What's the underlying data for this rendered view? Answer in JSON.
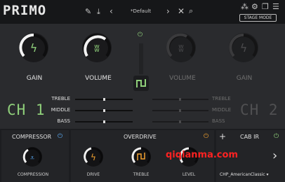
{
  "app": {
    "title": "PRIMO"
  },
  "toolbar": {
    "preset": "*Default",
    "stage_mode_label": "STAGE MODE"
  },
  "ch1": {
    "label": "CH 1",
    "gain_label": "GAIN",
    "volume_label": "VOLUME",
    "gain": 0.6,
    "volume": 0.7
  },
  "ch2": {
    "label": "CH 2",
    "gain_label": "GAIN",
    "volume_label": "VOLUME",
    "gain": 0.6,
    "volume": 0.6
  },
  "eq": {
    "treble_label": "TREBLE",
    "middle_label": "MIDDLE",
    "bass_label": "BASS",
    "ch1": {
      "treble": 0.5,
      "middle": 0.5,
      "bass": 0.5
    },
    "ch2": {
      "treble": 0.5,
      "middle": 0.5,
      "bass": 0.5
    }
  },
  "compressor": {
    "title": "COMPRESSOR",
    "knob_label": "COMPRESSION",
    "value": 0.3
  },
  "overdrive": {
    "title": "OVERDRIVE",
    "drive_label": "DRIVE",
    "treble_label": "TREBLE",
    "level_label": "LEVEL",
    "drive": 0.4,
    "treble": 0.5,
    "level": 0.5
  },
  "cabir": {
    "title": "CAB IR",
    "selected": "CHP_AmericanClassic"
  },
  "watermark": "qiqianma.com",
  "colors": {
    "accent_green": "#8fcf7a",
    "accent_orange": "#f0a030",
    "accent_blue": "#5aa8f0",
    "watermark": "#ff2222"
  }
}
